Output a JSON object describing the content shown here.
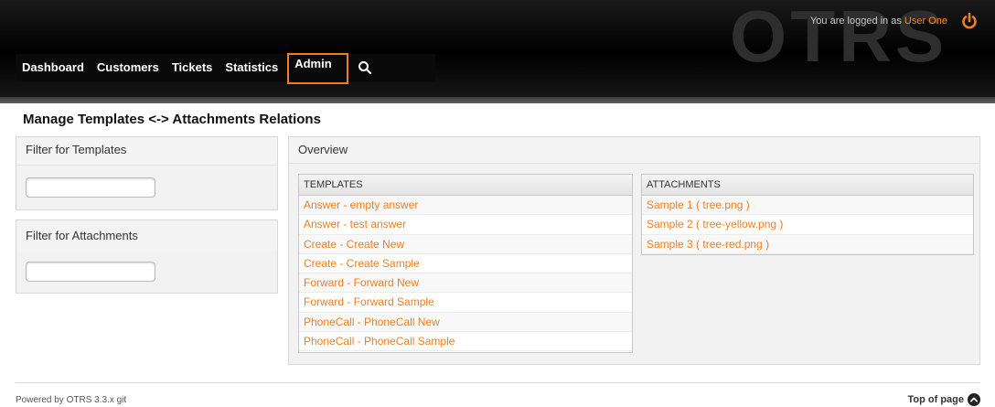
{
  "header": {
    "logo": "OTRS",
    "login_prefix": "You are logged in as",
    "user_name": "User One",
    "logout_icon": "power-icon"
  },
  "nav": {
    "items": [
      {
        "label": "Dashboard"
      },
      {
        "label": "Customers"
      },
      {
        "label": "Tickets"
      },
      {
        "label": "Statistics"
      },
      {
        "label": "Admin",
        "active": true
      }
    ],
    "search_icon": "search-icon"
  },
  "page": {
    "title": "Manage Templates <-> Attachments Relations"
  },
  "sidebar": {
    "templates_filter": {
      "label": "Filter for Templates",
      "value": ""
    },
    "attachments_filter": {
      "label": "Filter for Attachments",
      "value": ""
    }
  },
  "overview": {
    "label": "Overview",
    "templates": {
      "header": "TEMPLATES",
      "rows": [
        "Answer - empty answer",
        "Answer - test answer",
        "Create - Create New",
        "Create - Create Sample",
        "Forward - Forward New",
        "Forward - Forward Sample",
        "PhoneCall - PhoneCall New",
        "PhoneCall - PhoneCall Sample"
      ]
    },
    "attachments": {
      "header": "ATTACHMENTS",
      "rows": [
        "Sample 1 ( tree.png )",
        "Sample 2 ( tree-yellow.png )",
        "Sample 3 ( tree-red.png )"
      ]
    }
  },
  "footer": {
    "powered_by": "Powered by OTRS 3.3.x git",
    "top_of_page": "Top of page"
  },
  "colors": {
    "accent": "#f07e1e",
    "header_bg": "#000000"
  }
}
